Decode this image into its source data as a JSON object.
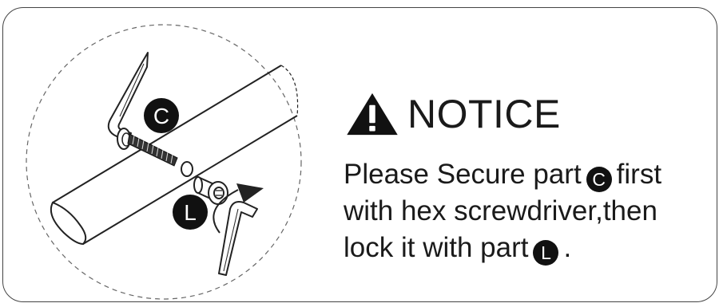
{
  "notice": {
    "title": "NOTICE",
    "line1_pre": "Please Secure part",
    "line1_badge": "C",
    "line1_post": "first",
    "line2": "with hex screwdriver,then",
    "line3_pre": "lock it with part",
    "line3_badge": "L",
    "line3_post": "."
  },
  "labels": {
    "part_c": "C",
    "part_l": "L"
  },
  "icons": [
    "warning-triangle-icon",
    "hex-key-icon",
    "bolt-icon",
    "washer-icon",
    "lock-cap-icon",
    "rotate-arrow-icon"
  ],
  "colors": {
    "ink": "#1a1a1a",
    "badge": "#111111",
    "border": "#444444"
  }
}
